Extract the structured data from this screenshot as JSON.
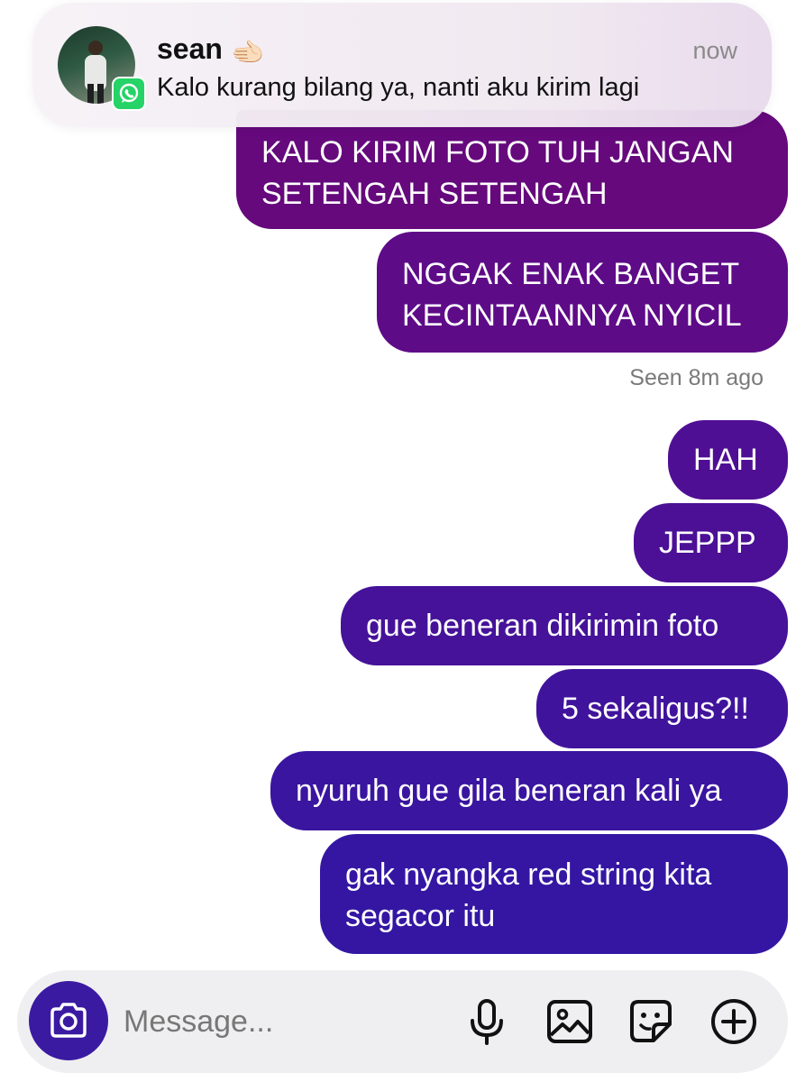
{
  "notification": {
    "name": "sean",
    "emoji": "🫲🏻",
    "time": "now",
    "message": "Kalo kurang bilang ya, nanti aku kirim lagi",
    "app_icon": "whatsapp-icon"
  },
  "messages": [
    {
      "text": "KALO KIRIM FOTO TUH JANGAN\nSETENGAH SETENGAH"
    },
    {
      "text": "NGGAK ENAK BANGET\nKECINTAANNYA NYICIL"
    },
    {
      "text": "HAH"
    },
    {
      "text": "JEPPP"
    },
    {
      "text": "gue beneran dikirimin foto"
    },
    {
      "text": "5 sekaligus?!!"
    },
    {
      "text": "nyuruh gue gila beneran kali ya"
    },
    {
      "text": "gak nyangka red string kita\nsegacor itu"
    }
  ],
  "seen_status": "Seen 8m ago",
  "composer": {
    "placeholder": "Message...",
    "icons": [
      "camera-icon",
      "microphone-icon",
      "gallery-icon",
      "sticker-icon",
      "plus-icon"
    ]
  },
  "colors": {
    "bubble_top": "#65097c",
    "bubble_bottom": "#3416a3",
    "camera_button": "#3b1aa2",
    "whatsapp_green": "#25d366"
  }
}
